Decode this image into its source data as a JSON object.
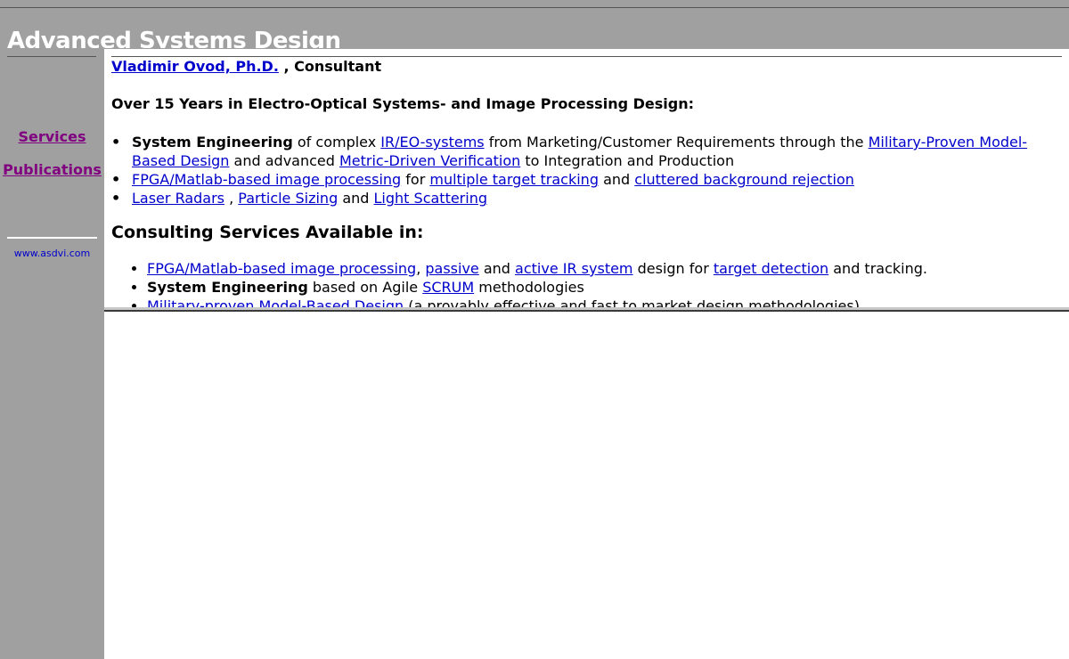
{
  "header": {
    "site_title": "Advanced Systems Design"
  },
  "sidebar": {
    "nav": [
      {
        "label": "Services"
      },
      {
        "label": "Publications"
      }
    ],
    "site_url": "www.asdvi.com"
  },
  "main": {
    "author_link": "Vladimir Ovod, Ph.D.",
    "author_role": " , Consultant",
    "subheading": "Over 15 Years in Electro-Optical Systems- and Image Processing Design:",
    "experience": {
      "item1": {
        "lead": "System Engineering",
        "t1": " of complex ",
        "l1": "IR/EO-systems",
        "t2": " from Marketing/Customer Requirements through the ",
        "l2": "Military-Proven Model-Based Design",
        "t3": " and advanced ",
        "l3": "Metric-Driven Verification",
        "t4": " to Integration and Production"
      },
      "item2": {
        "l1": "FPGA/Matlab-based image processing",
        "t1": " for ",
        "l2": "multiple target tracking",
        "t2": " and ",
        "l3": "cluttered background rejection"
      },
      "item3": {
        "l1": "Laser Radars",
        "t1": " , ",
        "l2": "Particle Sizing",
        "t2": " and ",
        "l3": "Light Scattering"
      }
    },
    "services_title": "Consulting Services Available in:",
    "services": {
      "item1": {
        "l1": "FPGA/Matlab-based image processing",
        "t1": ", ",
        "l2": "passive",
        "t2": " and ",
        "l3": "active IR system",
        "t3": " design for ",
        "l4": "target detection",
        "t4": " and tracking."
      },
      "item2": {
        "lead": "System Engineering",
        "t1": " based on Agile ",
        "l1": "SCRUM",
        "t2": " methodologies"
      },
      "item3": {
        "l1": "Military-proven Model-Based Design",
        "t1": " (a provably effective and fast to market design methodologies)"
      }
    }
  }
}
